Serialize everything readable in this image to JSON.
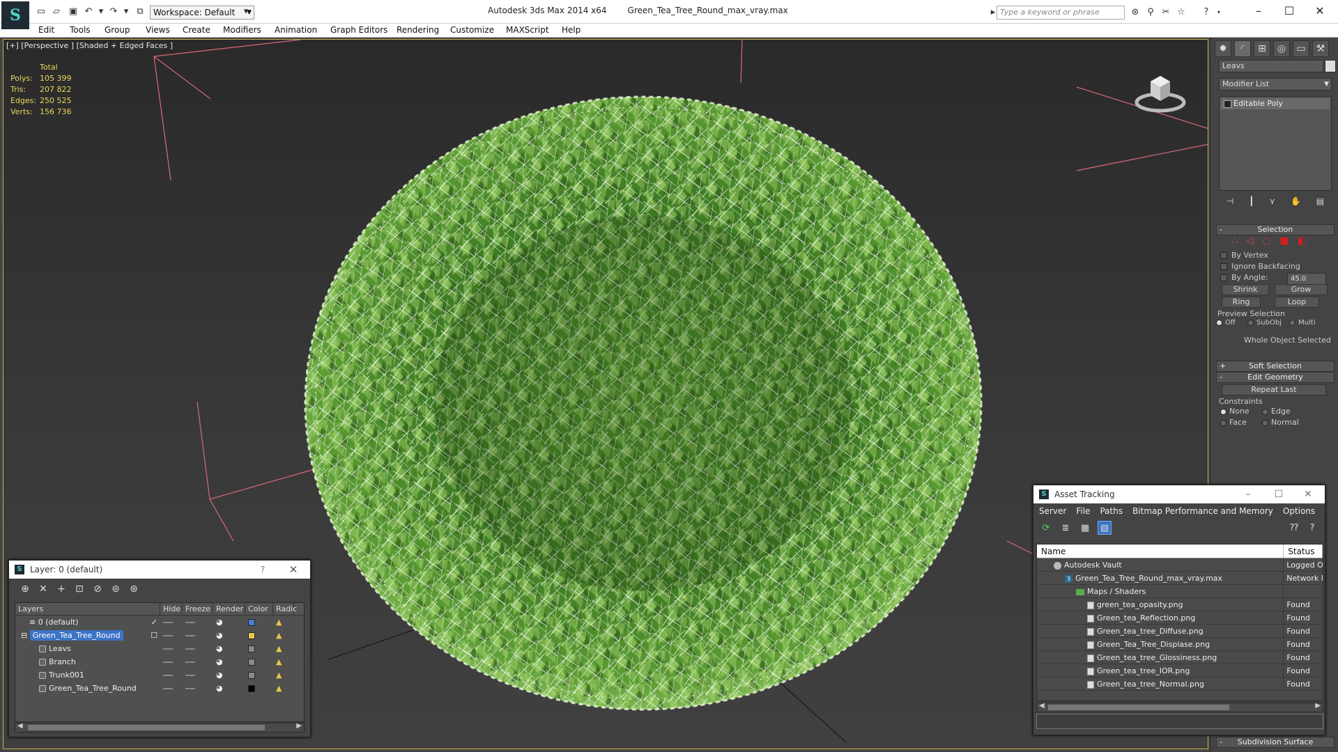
{
  "title": {
    "app": "Autodesk 3ds Max  2014 x64",
    "file": "Green_Tea_Tree_Round_max_vray.max",
    "workspace": "Workspace: Default",
    "search_placeholder": "Type a keyword or phrase"
  },
  "menu": [
    "Edit",
    "Tools",
    "Group",
    "Views",
    "Create",
    "Modifiers",
    "Animation",
    "Graph Editors",
    "Rendering",
    "Customize",
    "MAXScript",
    "Help"
  ],
  "viewport": {
    "label": "[+] [Perspective ] [Shaded + Edged Faces ]",
    "stats": {
      "header": "Total",
      "polys_label": "Polys:",
      "polys": "105 399",
      "tris_label": "Tris:",
      "tris": "207 822",
      "edges_label": "Edges:",
      "edges": "250 525",
      "verts_label": "Verts:",
      "verts": "156 736"
    }
  },
  "command_panel": {
    "object_name": "Leavs",
    "modifier_list": "Modifier List",
    "stack_item": "Editable Poly",
    "selection": {
      "title": "Selection",
      "by_vertex": "By Vertex",
      "ignore_backfacing": "Ignore Backfacing",
      "by_angle": "By Angle:",
      "angle_value": "45.0",
      "shrink": "Shrink",
      "grow": "Grow",
      "ring": "Ring",
      "loop": "Loop",
      "preview_title": "Preview Selection",
      "preview_off": "Off",
      "preview_subobj": "SubObj",
      "preview_multi": "Multi",
      "status": "Whole Object Selected"
    },
    "soft_selection": "Soft Selection",
    "edit_geometry": {
      "title": "Edit Geometry",
      "repeat_last": "Repeat Last",
      "constraints": "Constraints",
      "none": "None",
      "edge": "Edge",
      "face": "Face",
      "normal": "Normal"
    },
    "subdivision_surface": "Subdivision Surface",
    "accent_color": "#cc1f1f"
  },
  "layer_dialog": {
    "title": "Layer: 0 (default)",
    "help": "?",
    "columns": [
      "Layers",
      "Hide",
      "Freeze",
      "Render",
      "Color",
      "Radic"
    ],
    "rows": [
      {
        "name": "0 (default)",
        "color": "#4a7cd6",
        "check": "✓"
      },
      {
        "name": "Green_Tea_Tree_Round",
        "color": "#e6c84a",
        "check": "☐"
      },
      {
        "name": "Leavs",
        "color": "#8a8a8a",
        "check": ""
      },
      {
        "name": "Branch",
        "color": "#8a8a8a",
        "check": ""
      },
      {
        "name": "Trunk001",
        "color": "#8a8a8a",
        "check": ""
      },
      {
        "name": "Green_Tea_Tree_Round",
        "color": "#000000",
        "check": ""
      }
    ]
  },
  "asset_dialog": {
    "title": "Asset Tracking",
    "menu": [
      "Server",
      "File",
      "Paths",
      "Bitmap Performance and Memory",
      "Options"
    ],
    "columns": [
      "Name",
      "Status"
    ],
    "rows": [
      {
        "name": "Autodesk Vault",
        "status": "Logged O",
        "indent": 1,
        "icon": "vault"
      },
      {
        "name": "Green_Tea_Tree_Round_max_vray.max",
        "status": "Network P",
        "indent": 2,
        "icon": "max"
      },
      {
        "name": "Maps / Shaders",
        "status": "",
        "indent": 3,
        "icon": "folder"
      },
      {
        "name": "green_tea_opasity.png",
        "status": "Found",
        "indent": 4,
        "icon": "file"
      },
      {
        "name": "Green_tea_Reflection.png",
        "status": "Found",
        "indent": 4,
        "icon": "file"
      },
      {
        "name": "Green_tea_tree_Diffuse.png",
        "status": "Found",
        "indent": 4,
        "icon": "file"
      },
      {
        "name": "Green_Tea_Tree_Displase.png",
        "status": "Found",
        "indent": 4,
        "icon": "file"
      },
      {
        "name": "Green_tea_tree_Glossiness.png",
        "status": "Found",
        "indent": 4,
        "icon": "file"
      },
      {
        "name": "Green_tea_tree_IOR.png",
        "status": "Found",
        "indent": 4,
        "icon": "file"
      },
      {
        "name": "Green_tea_tree_Normal.png",
        "status": "Found",
        "indent": 4,
        "icon": "file"
      }
    ]
  }
}
